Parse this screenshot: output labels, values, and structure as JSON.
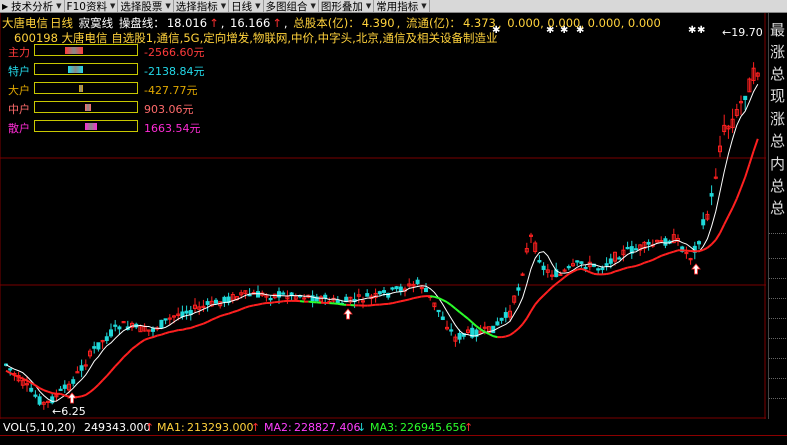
{
  "toolbar": {
    "items": [
      {
        "label": "技术分析",
        "dropdown": true,
        "lead": "▶"
      },
      {
        "label": "F10资料",
        "dropdown": true
      },
      {
        "label": "选择股票",
        "dropdown": true
      },
      {
        "label": "选择指标",
        "dropdown": true
      },
      {
        "label": "日线",
        "dropdown": true
      },
      {
        "label": "多图组合",
        "dropdown": true
      },
      {
        "label": "图形叠加",
        "dropdown": true
      },
      {
        "label": "常用指标",
        "dropdown": true
      }
    ]
  },
  "header": {
    "stock_name": "大唐电信",
    "period": "日线",
    "indicator": "寂寞线",
    "label_caopan": "操盘线：",
    "caopan_v1": "18.016",
    "caopan_v2": "16.166",
    "label_guben": "总股本(亿)：",
    "guben": "4.390",
    "label_liutong": "流通(亿)：",
    "liutong": "4.373",
    "zeros": "0.000, 0.000, 0.000, 0.000",
    "subline": "600198 大唐电信 自选股1,通信,5G,定向增发,物联网,中价,中字头,北京,通信及相关设备制造业"
  },
  "money_flow": [
    {
      "label": "主力",
      "value": "-2566.60元",
      "color": "#ff3b3b",
      "fraction": 0.18,
      "side": "left"
    },
    {
      "label": "特户",
      "value": "-2138.84元",
      "color": "#23d8e8",
      "fraction": 0.15,
      "side": "left"
    },
    {
      "label": "大户",
      "value": "-427.77元",
      "color": "#e0a800",
      "fraction": 0.03,
      "side": "left"
    },
    {
      "label": "中户",
      "value": "903.06元",
      "color": "#ff6b6b",
      "fraction": 0.06,
      "side": "right"
    },
    {
      "label": "散户",
      "value": "1663.54元",
      "color": "#ff2bd6",
      "fraction": 0.12,
      "side": "right"
    }
  ],
  "chart_data": {
    "type": "candlestick",
    "high_label": "19.70",
    "low_label": "6.25",
    "y_range": [
      6.0,
      20.0
    ],
    "up_color": "#ff2020",
    "down_color": "#20d8d8",
    "ma_fast_color": "#ffffff",
    "ma_slow_color": "#ff2020",
    "ma_slow_down_color": "#2bff2b"
  },
  "volume": {
    "label": "VOL(5,10,20)",
    "vol": "249343.000",
    "ma1_label": "MA1:",
    "ma1": "213293.000",
    "ma2_label": "MA2:",
    "ma2": "228827.406",
    "ma3_label": "MA3:",
    "ma3": "226945.656"
  },
  "side_panel": [
    "最",
    "涨",
    "总",
    "现",
    "涨",
    "总",
    "内",
    "总",
    "总"
  ]
}
